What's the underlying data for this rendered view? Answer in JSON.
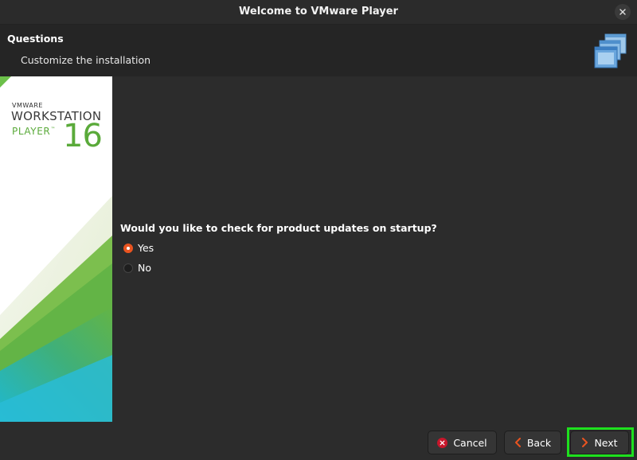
{
  "window": {
    "title": "Welcome to VMware Player"
  },
  "header": {
    "title": "Questions",
    "subtitle": "Customize the installation",
    "icon": "vmware-windows-icon"
  },
  "sidebar": {
    "brand_vmware": "VMWARE",
    "brand_product": "WORKSTATION",
    "brand_edition": "PLAYER",
    "brand_tm": "™",
    "brand_version": "16",
    "colors": {
      "green": "#5aaa3a",
      "teal": "#1fb8d0"
    }
  },
  "main": {
    "question": "Would you like to check for product updates on startup?",
    "options": [
      {
        "label": "Yes",
        "selected": true
      },
      {
        "label": "No",
        "selected": false
      }
    ]
  },
  "footer": {
    "cancel_label": "Cancel",
    "back_label": "Back",
    "next_label": "Next"
  },
  "colors": {
    "accent": "#e95420",
    "focus_highlight": "#1ee01e",
    "background": "#2c2c2c"
  }
}
